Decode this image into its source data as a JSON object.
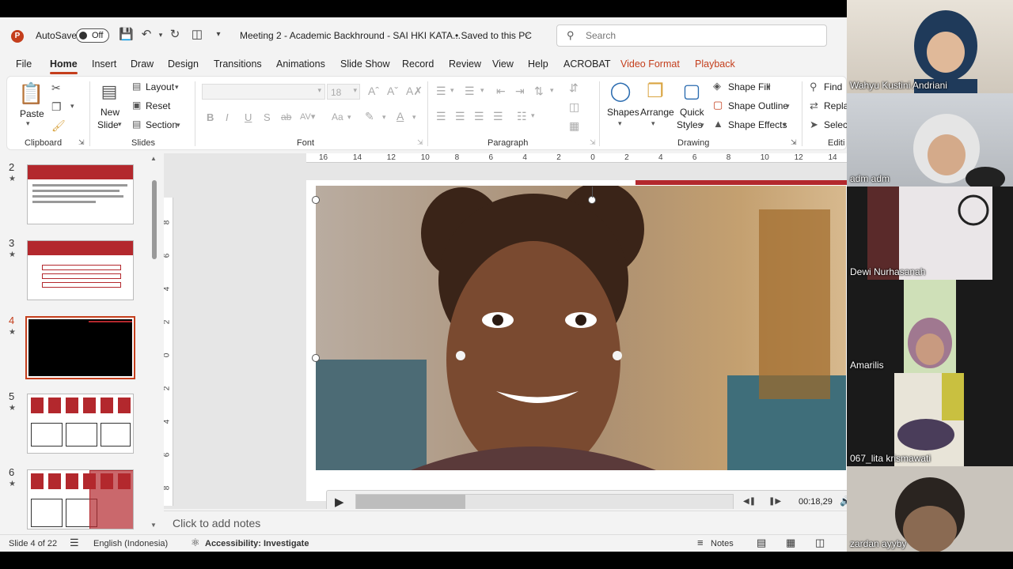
{
  "titlebar": {
    "app_logo": "P",
    "autosave_label": "AutoSave",
    "autosave_state": "Off",
    "doc_title": "Meeting 2 - Academic Backhround - SAI HKI KATA...",
    "saved_status": "• Saved to this PC",
    "search_placeholder": "Search"
  },
  "tabs": [
    "File",
    "Home",
    "Insert",
    "Draw",
    "Design",
    "Transitions",
    "Animations",
    "Slide Show",
    "Record",
    "Review",
    "View",
    "Help",
    "ACROBAT",
    "Video Format",
    "Playback"
  ],
  "active_tab": "Home",
  "ribbon": {
    "clipboard": {
      "label": "Clipboard",
      "paste": "Paste"
    },
    "slides": {
      "label": "Slides",
      "new_slide_line1": "New",
      "new_slide_line2": "Slide",
      "layout": "Layout",
      "reset": "Reset",
      "section": "Section"
    },
    "font": {
      "label": "Font",
      "font_size": "18",
      "bold": "B",
      "italic": "I",
      "underline": "U",
      "strike": "S",
      "abc": "ab",
      "aa": "Aa"
    },
    "paragraph": {
      "label": "Paragraph"
    },
    "drawing": {
      "label": "Drawing",
      "shapes": "Shapes",
      "arrange": "Arrange",
      "quick_styles_line1": "Quick",
      "quick_styles_line2": "Styles",
      "shape_fill": "Shape Fill",
      "shape_outline": "Shape Outline",
      "shape_effects": "Shape Effects"
    },
    "editing": {
      "label": "Editi",
      "find": "Find",
      "replace": "Replac",
      "select": "Select"
    }
  },
  "slide_panel": {
    "slides": [
      {
        "number": "2"
      },
      {
        "number": "3"
      },
      {
        "number": "4",
        "selected": true
      },
      {
        "number": "5"
      },
      {
        "number": "6"
      }
    ]
  },
  "ruler": {
    "h_ticks": [
      "16",
      "14",
      "12",
      "10",
      "8",
      "6",
      "4",
      "2",
      "0",
      "2",
      "4",
      "6",
      "8",
      "10",
      "12",
      "14"
    ],
    "v_ticks": [
      "8",
      "6",
      "4",
      "2",
      "0",
      "2",
      "4",
      "6",
      "8"
    ]
  },
  "video": {
    "time": "00:18,29",
    "progress": 0.29
  },
  "notes_placeholder": "Click to add notes",
  "status": {
    "slide_info": "Slide 4 of 22",
    "language": "English (Indonesia)",
    "accessibility": "Accessibility: Investigate",
    "notes": "Notes"
  },
  "participants": [
    {
      "name": "Wahyu Kustini Andriani"
    },
    {
      "name": "adm adm"
    },
    {
      "name": "Dewi Nurhasanah"
    },
    {
      "name": "Amarilis"
    },
    {
      "name": "067_lita krismawati"
    },
    {
      "name": "zardan ayyby"
    }
  ],
  "colors": {
    "accent": "#c43e1c",
    "slide_red": "#b3282d"
  }
}
